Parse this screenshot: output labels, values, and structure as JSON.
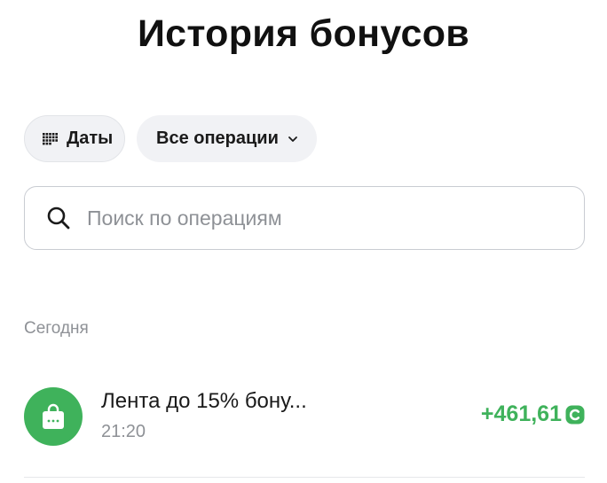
{
  "page": {
    "title": "История бонусов"
  },
  "filters": {
    "dates_label": "Даты",
    "operations_label": "Все операции"
  },
  "search": {
    "placeholder": "Поиск по операциям"
  },
  "sections": [
    {
      "label": "Сегодня",
      "items": [
        {
          "title": "Лента до 15% бону...",
          "time": "21:20",
          "amount": "+461,61",
          "icon": "shopping-bag-icon",
          "currency_icon": "bonus-coin-icon"
        }
      ]
    }
  ],
  "colors": {
    "accent_green": "#3fb25b",
    "chip_bg": "#f1f2f5",
    "muted_text": "#8e9196"
  }
}
